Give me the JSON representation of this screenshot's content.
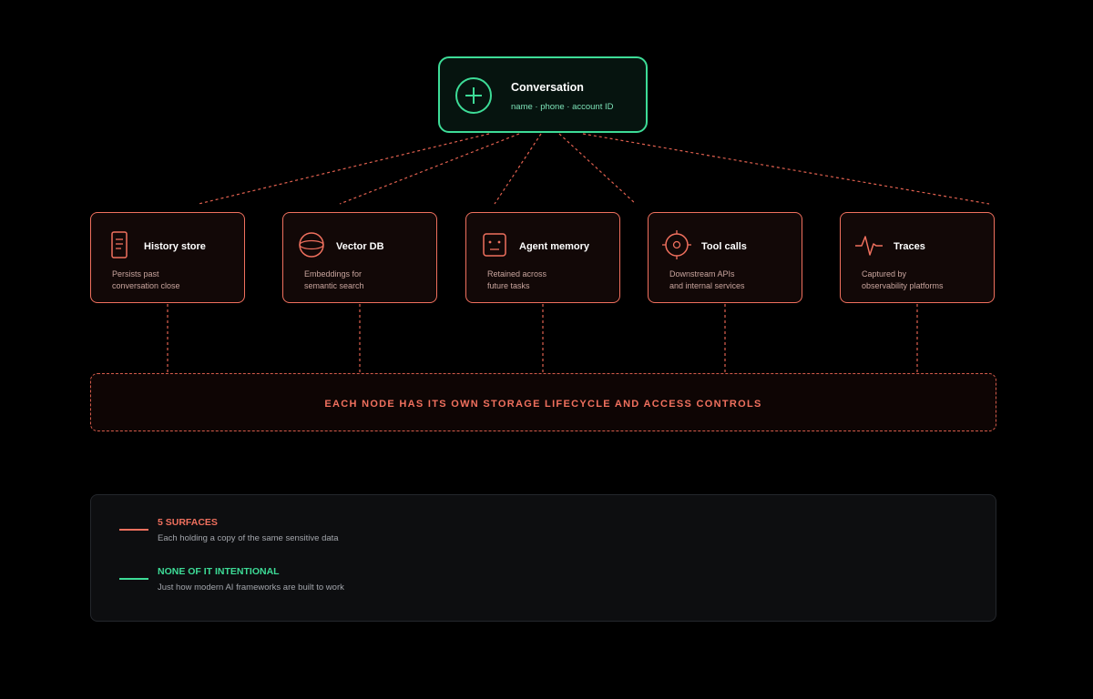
{
  "diagram": {
    "root": {
      "title": "Conversation",
      "subtitle": "name · phone · account ID",
      "icon": "plus-circle-icon",
      "color": "#3ddc97"
    },
    "nodes": [
      {
        "id": "history-store",
        "title": "History store",
        "desc": "Persists past\nconversation close",
        "icon": "document-icon"
      },
      {
        "id": "vector-db",
        "title": "Vector DB",
        "desc": "Embeddings for\nsemantic search",
        "icon": "sphere-icon"
      },
      {
        "id": "agent-memory",
        "title": "Agent memory",
        "desc": "Retained across\nfuture tasks",
        "icon": "robot-face-icon"
      },
      {
        "id": "tool-calls",
        "title": "Tool calls",
        "desc": "Downstream APIs\nand internal services",
        "icon": "crosshair-icon"
      },
      {
        "id": "traces",
        "title": "Traces",
        "desc": "Captured by\nobservability platforms",
        "icon": "pulse-icon"
      }
    ],
    "node_color": "#f0705e",
    "banner": "EACH NODE HAS ITS OWN STORAGE LIFECYCLE AND ACCESS CONTROLS"
  },
  "legend": [
    {
      "title": "5 SURFACES",
      "desc": "Each holding a copy of the same sensitive data",
      "color": "#f0705e"
    },
    {
      "title": "NONE OF IT INTENTIONAL",
      "desc": "Just how modern AI frameworks are built to work",
      "color": "#3ddc97"
    }
  ]
}
